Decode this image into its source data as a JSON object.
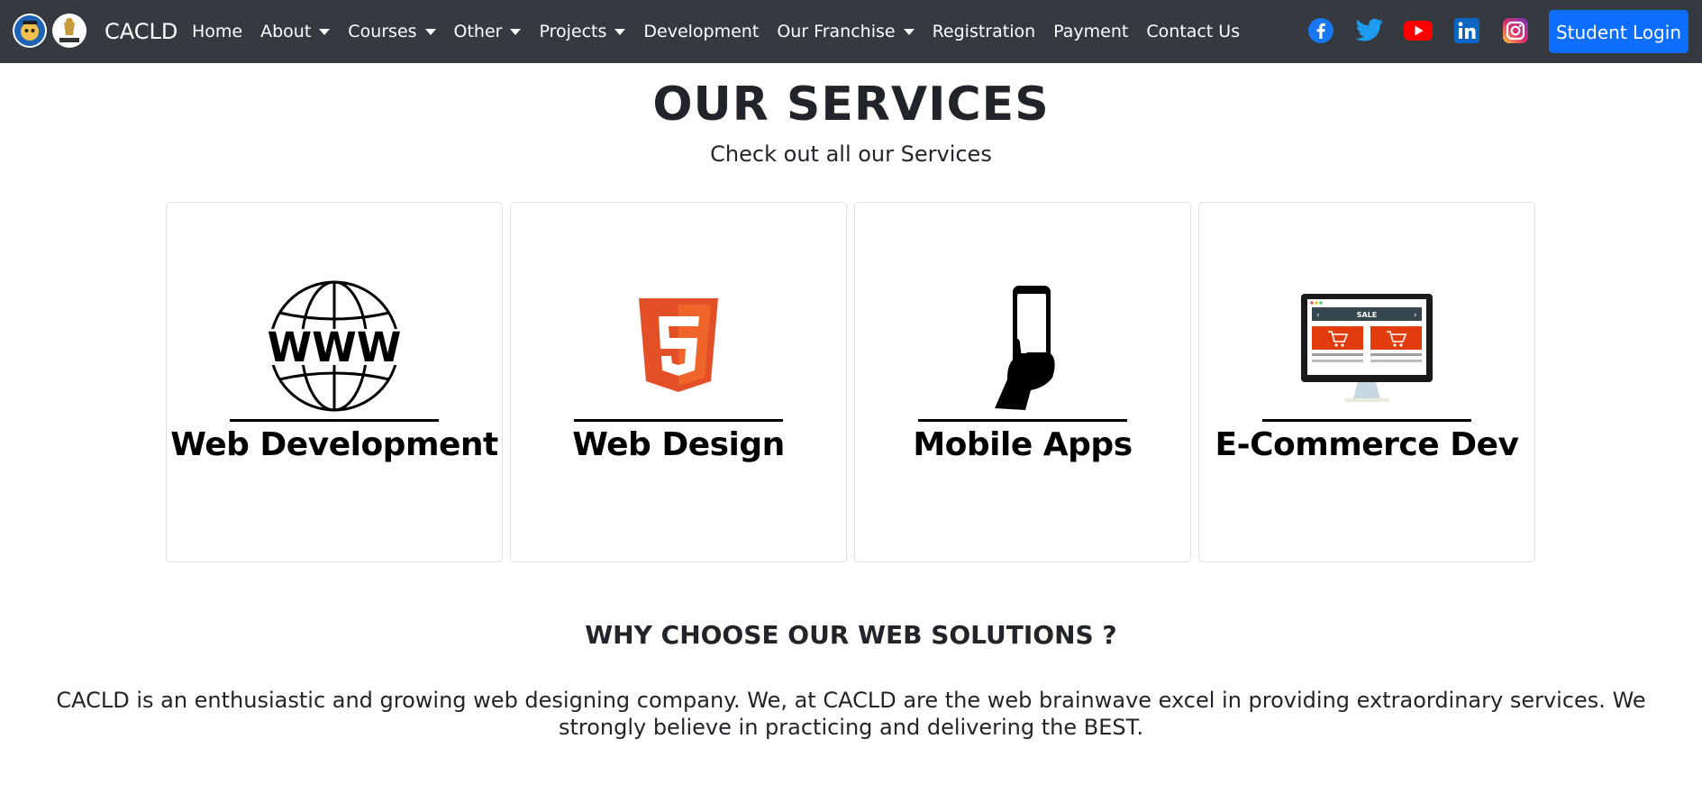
{
  "nav": {
    "brand": "CACLD",
    "items": [
      {
        "label": "Home",
        "dropdown": false
      },
      {
        "label": "About",
        "dropdown": true
      },
      {
        "label": "Courses",
        "dropdown": true
      },
      {
        "label": "Other",
        "dropdown": true
      },
      {
        "label": "Projects",
        "dropdown": true
      },
      {
        "label": "Development",
        "dropdown": false
      },
      {
        "label": "Our Franchise",
        "dropdown": true
      },
      {
        "label": "Registration",
        "dropdown": false
      },
      {
        "label": "Payment",
        "dropdown": false
      },
      {
        "label": "Contact Us",
        "dropdown": false
      }
    ],
    "socials": [
      "facebook-icon",
      "twitter-icon",
      "youtube-icon",
      "linkedin-icon",
      "instagram-icon"
    ],
    "login_label": "Student Login"
  },
  "services": {
    "title": "OUR SERVICES",
    "subtitle": "Check out all our Services",
    "cards": [
      {
        "label": "Web Development",
        "icon": "www-globe-icon"
      },
      {
        "label": "Web Design",
        "icon": "html5-icon"
      },
      {
        "label": "Mobile Apps",
        "icon": "phone-in-hand-icon"
      },
      {
        "label": "E-Commerce Dev",
        "icon": "desktop-shop-icon"
      }
    ]
  },
  "why": {
    "heading": "WHY CHOOSE OUR WEB SOLUTIONS ?",
    "text": "CACLD is an enthusiastic and growing web designing company. We, at CACLD are the web brainwave excel in providing extraordinary services. We strongly believe in practicing and delivering the BEST."
  },
  "colors": {
    "navbar": "#343a40",
    "primary": "#0d6efd",
    "facebook": "#1877f2",
    "twitter": "#1d9bf0",
    "youtube": "#ff0000",
    "linkedin": "#0a66c2",
    "html5": "#e34f26"
  }
}
